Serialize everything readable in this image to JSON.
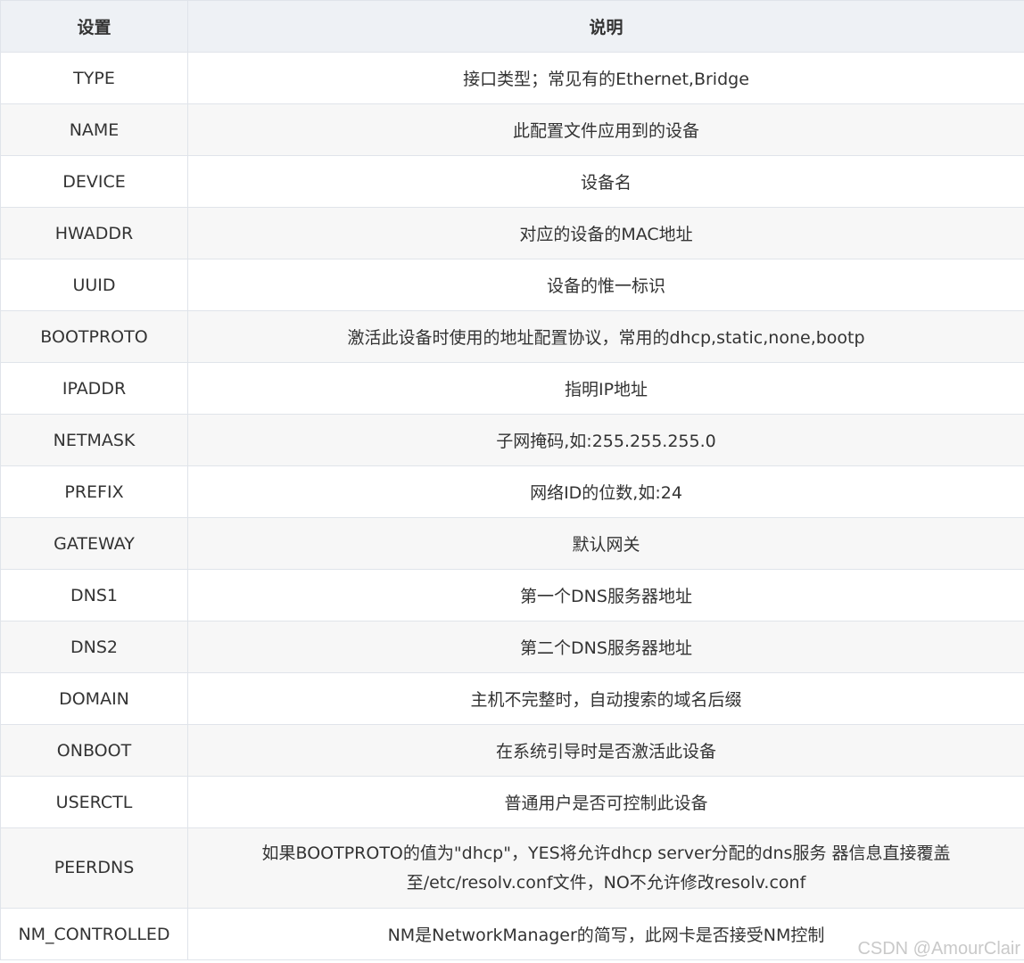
{
  "table": {
    "headers": [
      "设置",
      "说明"
    ],
    "rows": [
      {
        "setting": "TYPE",
        "desc": "接口类型；常见有的Ethernet,Bridge"
      },
      {
        "setting": "NAME",
        "desc": "此配置文件应用到的设备"
      },
      {
        "setting": "DEVICE",
        "desc": "设备名"
      },
      {
        "setting": "HWADDR",
        "desc": "对应的设备的MAC地址"
      },
      {
        "setting": "UUID",
        "desc": "设备的惟一标识"
      },
      {
        "setting": "BOOTPROTO",
        "desc": "激活此设备时使用的地址配置协议，常用的dhcp,static,none,bootp"
      },
      {
        "setting": "IPADDR",
        "desc": "指明IP地址"
      },
      {
        "setting": "NETMASK",
        "desc": "子网掩码,如:255.255.255.0"
      },
      {
        "setting": "PREFIX",
        "desc": "网络ID的位数,如:24"
      },
      {
        "setting": "GATEWAY",
        "desc": "默认网关"
      },
      {
        "setting": "DNS1",
        "desc": "第一个DNS服务器地址"
      },
      {
        "setting": "DNS2",
        "desc": "第二个DNS服务器地址"
      },
      {
        "setting": "DOMAIN",
        "desc": "主机不完整时，自动搜索的域名后缀"
      },
      {
        "setting": "ONBOOT",
        "desc": "在系统引导时是否激活此设备"
      },
      {
        "setting": "USERCTL",
        "desc": "普通用户是否可控制此设备"
      },
      {
        "setting": "PEERDNS",
        "desc": "如果BOOTPROTO的值为\"dhcp\"，YES将允许dhcp server分配的dns服务 器信息直接覆盖至/etc/resolv.conf文件，NO不允许修改resolv.conf"
      },
      {
        "setting": "NM_CONTROLLED",
        "desc": "NM是NetworkManager的简写，此网卡是否接受NM控制"
      }
    ]
  },
  "watermark": "CSDN @AmourClair"
}
